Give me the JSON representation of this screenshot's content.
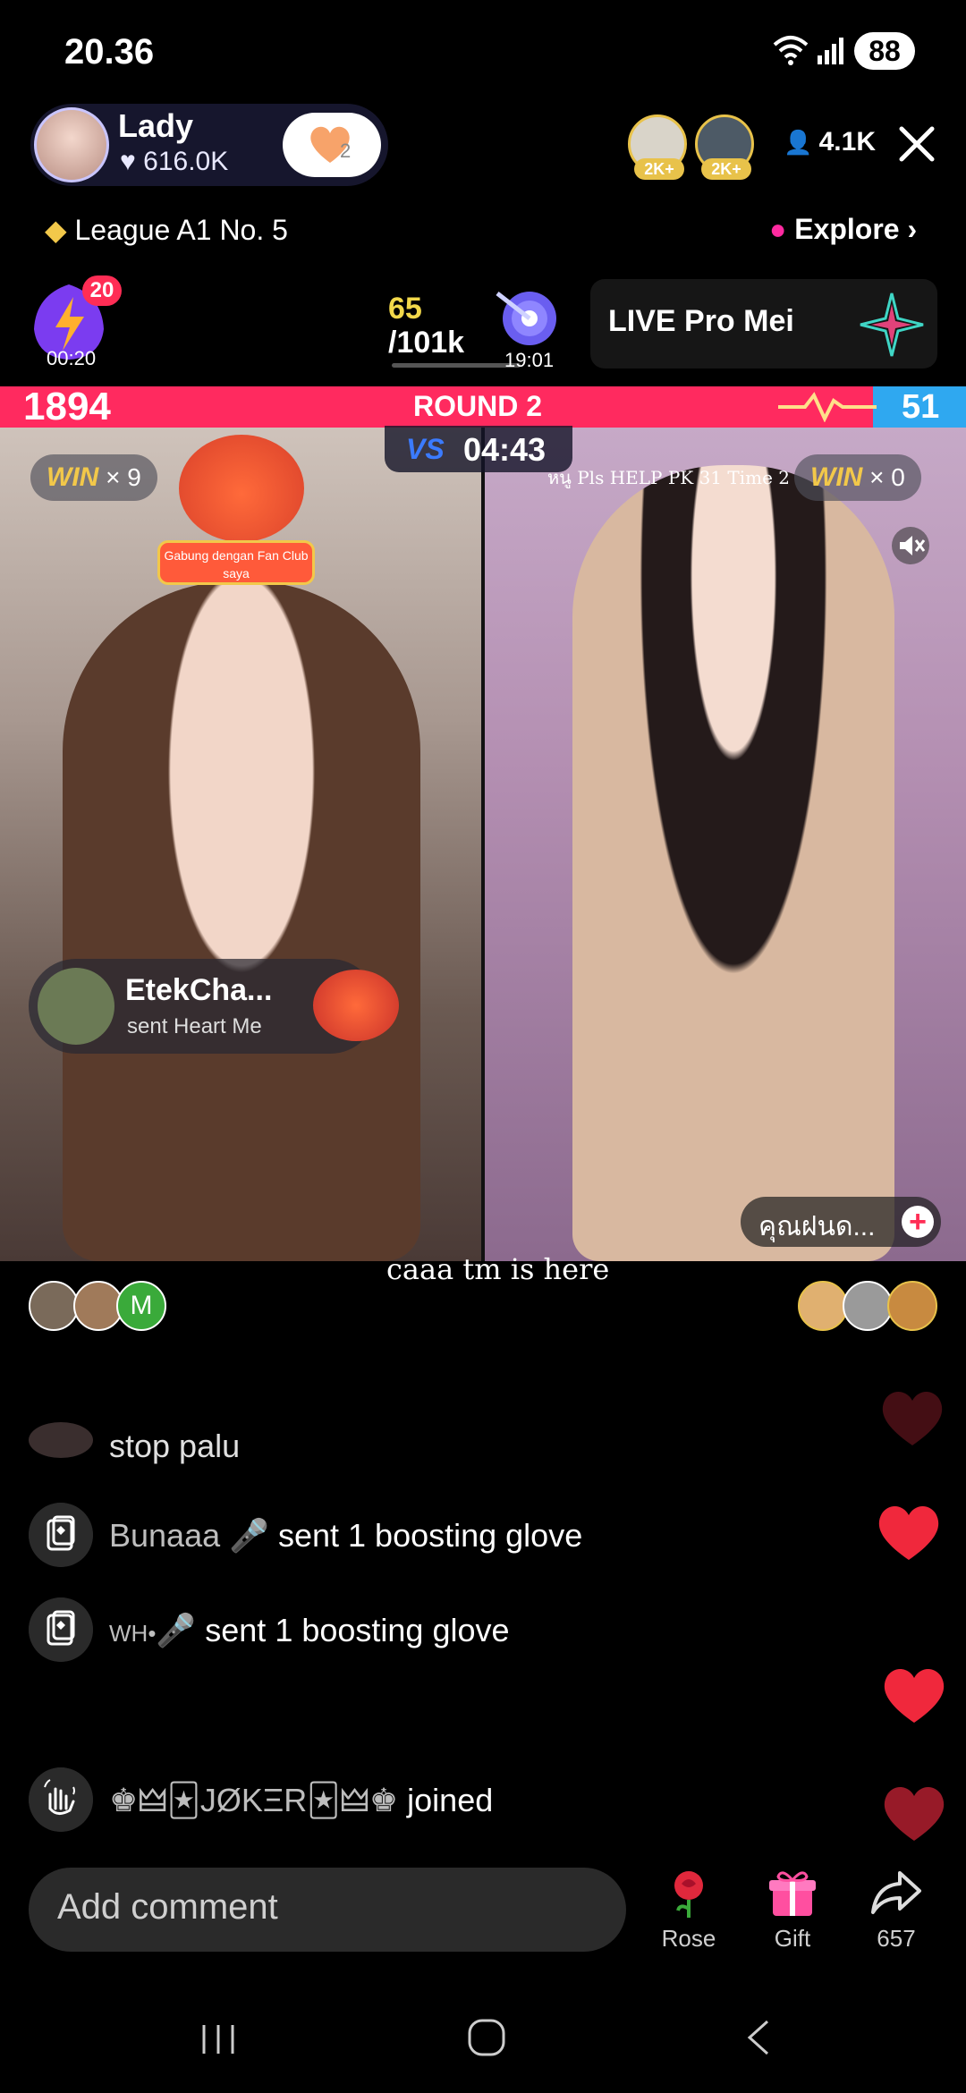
{
  "status_bar": {
    "time": "20.36",
    "battery": "88"
  },
  "host": {
    "name": "Lady",
    "likes": "616.0K",
    "follow_badge": "2"
  },
  "top_viewers": [
    {
      "badge": "2K+"
    },
    {
      "badge": "2K+"
    }
  ],
  "viewer_count": "4.1K",
  "league": {
    "label": "League A1 No. 5"
  },
  "explore": {
    "label": "Explore"
  },
  "boost": {
    "badge": "20",
    "time": "00:20"
  },
  "goal": {
    "current": "65",
    "total": "/101k",
    "time": "19:01"
  },
  "live_card": {
    "title": "LIVE Pro Mei"
  },
  "pk": {
    "score_left": "1894",
    "round": "ROUND 2",
    "score_right": "51",
    "vs": "VS",
    "timer": "04:43",
    "win_left_label": "WIN",
    "win_left_count": "× 9",
    "win_right_label": "WIN",
    "win_right_count": "× 0",
    "fanclub_text": "Gabung dengan Fan Club saya",
    "right_overlay_text": "หนู Pls HELP    PK 31 Time 2"
  },
  "gift_notification": {
    "user": "EtekCha...",
    "text": "sent Heart Me"
  },
  "recommend": {
    "name": "คุณฝนด...",
    "add": "+"
  },
  "caption": "caaa tm is here",
  "supporters_left": [
    {
      "letter": ""
    },
    {
      "letter": ""
    },
    {
      "letter": "M"
    }
  ],
  "chat": [
    {
      "user": "",
      "text": "stop palu",
      "icon": "avatar"
    },
    {
      "user": "Bunaaa",
      "text": "sent 1 boosting glove",
      "icon": "gift-card-icon"
    },
    {
      "user": "WH•",
      "text": "sent 1 boosting glove",
      "icon": "gift-card-icon"
    },
    {
      "user": "♚🜲🃏JØKΞR🃏🜲♚",
      "text": "joined",
      "icon": "wave-hand-icon"
    }
  ],
  "bottom": {
    "comment_placeholder": "Add comment",
    "rose_label": "Rose",
    "gift_label": "Gift",
    "share_count": "657"
  },
  "colors": {
    "pk_red": "#ff2a5f",
    "pk_blue": "#2fa8f0",
    "heart_red": "#f0283c",
    "gold": "#f2c84a"
  }
}
